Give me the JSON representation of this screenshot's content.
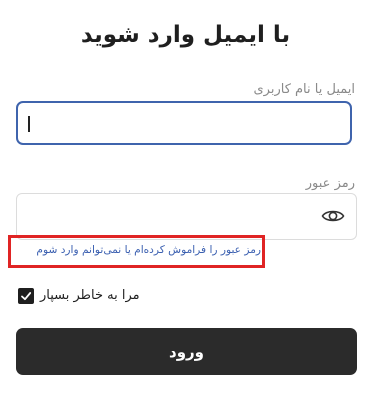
{
  "header": {
    "title": "با ایمیل وارد شوید"
  },
  "form": {
    "email_label": "ایمیل یا نام کاربری",
    "email_value": "",
    "password_label": "رمز عبور",
    "password_value": "",
    "password_toggle_icon": "eye-icon",
    "forgot_link": "رمز عبور را فراموش کرده‌ام یا نمی‌توانم وارد شوم",
    "remember_label": "مرا به خاطر بسپار",
    "remember_checked": true,
    "login_button": "ورود"
  },
  "colors": {
    "focus_border": "#3f64ad",
    "link": "#3a5fb0",
    "highlight_border": "#e02424",
    "button_bg": "#2b2b2b"
  }
}
